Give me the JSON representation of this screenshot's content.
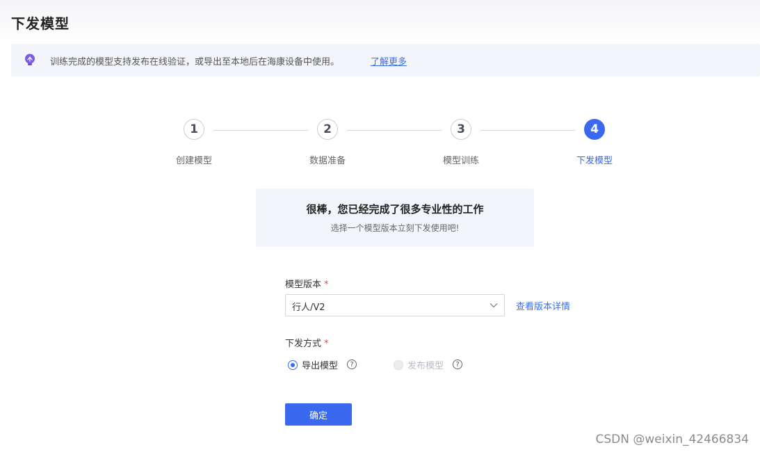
{
  "page": {
    "title": "下发模型"
  },
  "tip": {
    "icon": "lightbulb-icon",
    "text": "训练完成的模型支持发布在线验证，或导出至本地后在海康设备中使用。",
    "link": "了解更多"
  },
  "steps": [
    {
      "number": "1",
      "label": "创建模型",
      "active": false
    },
    {
      "number": "2",
      "label": "数据准备",
      "active": false
    },
    {
      "number": "3",
      "label": "模型训练",
      "active": false
    },
    {
      "number": "4",
      "label": "下发模型",
      "active": true
    }
  ],
  "congrats": {
    "title": "很棒，您已经完成了很多专业性的工作",
    "subtitle": "选择一个模型版本立刻下发使用吧!"
  },
  "form": {
    "version_label": "模型版本",
    "required_mark": "*",
    "version_value": "行人/V2",
    "version_detail_link": "查看版本详情",
    "method_label": "下发方式",
    "methods": [
      {
        "label": "导出模型",
        "checked": true,
        "disabled": false
      },
      {
        "label": "发布模型",
        "checked": false,
        "disabled": true
      }
    ],
    "help_glyph": "?",
    "confirm_label": "确定"
  },
  "watermark": "CSDN @weixin_42466834",
  "colors": {
    "primary": "#3a69f0",
    "link": "#3b6fe8",
    "required": "#e4483f",
    "tip_background": "#f3f5fb"
  }
}
